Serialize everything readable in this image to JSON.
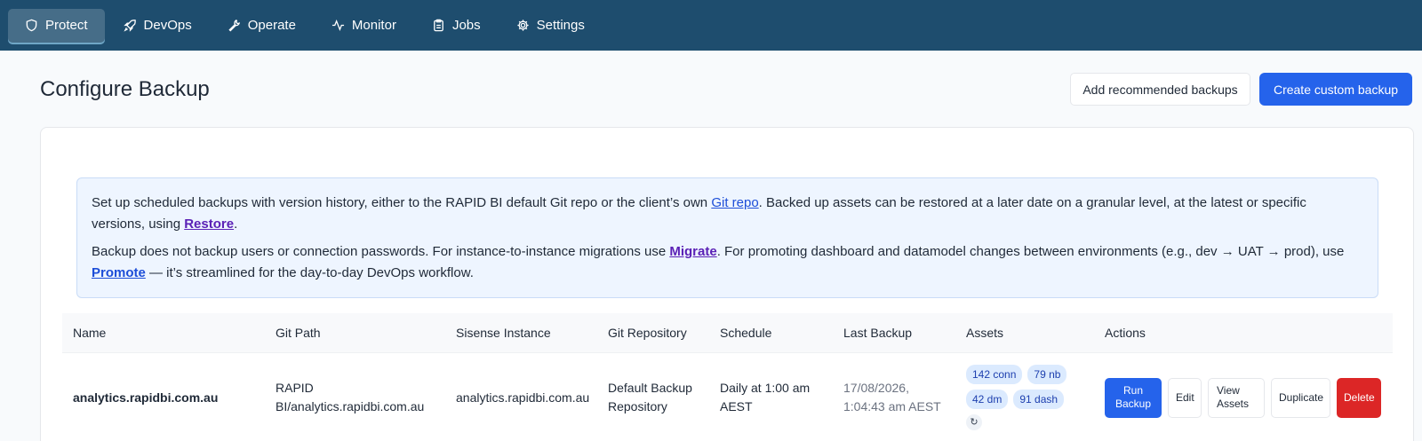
{
  "nav": {
    "items": [
      {
        "label": "Protect",
        "icon": "shield-icon",
        "active": true
      },
      {
        "label": "DevOps",
        "icon": "rocket-icon",
        "active": false
      },
      {
        "label": "Operate",
        "icon": "wrench-icon",
        "active": false
      },
      {
        "label": "Monitor",
        "icon": "activity-icon",
        "active": false
      },
      {
        "label": "Jobs",
        "icon": "clipboard-icon",
        "active": false
      },
      {
        "label": "Settings",
        "icon": "gear-icon",
        "active": false
      }
    ]
  },
  "header": {
    "title": "Configure Backup",
    "add_recommended_label": "Add recommended backups",
    "create_custom_label": "Create custom backup"
  },
  "info": {
    "p1_text1": "Set up scheduled backups with version history, either to the RAPID BI default Git repo or the client’s own ",
    "p1_link1": "Git repo",
    "p1_text2": ". Backed up assets can be restored at a later date on a granular level, at the latest or specific versions, using ",
    "p1_link2": "Restore",
    "p1_text3": ".",
    "p2_text1": "Backup does not backup users or connection passwords. For instance-to-instance migrations use ",
    "p2_link1": "Migrate",
    "p2_text2": ". For promoting dashboard and datamodel changes between environments (e.g., dev → UAT → prod), use ",
    "p2_link2": "Promote",
    "p2_text3": " — it’s streamlined for the day-to-day DevOps workflow."
  },
  "table": {
    "columns": [
      "Name",
      "Git Path",
      "Sisense Instance",
      "Git Repository",
      "Schedule",
      "Last Backup",
      "Assets",
      "Actions"
    ],
    "rows": [
      {
        "name": "analytics.rapidbi.com.au",
        "git_path_1": "RAPID",
        "git_path_2": "BI/analytics.rapidbi.com.au",
        "instance": "analytics.rapidbi.com.au",
        "repo_1": "Default Backup",
        "repo_2": "Repository",
        "schedule_1": "Daily at 1:00 am",
        "schedule_2": "AEST",
        "last_backup_1": "17/08/2026,",
        "last_backup_2": "1:04:43 am AEST",
        "assets": [
          "142 conn",
          "79 nb",
          "42 dm",
          "91 dash"
        ],
        "refresh_icon": "↻",
        "actions": {
          "run_1": "Run",
          "run_2": "Backup",
          "edit": "Edit",
          "view_1": "View",
          "view_2": "Assets",
          "duplicate": "Duplicate",
          "delete": "Delete"
        }
      }
    ]
  },
  "colors": {
    "nav_bg": "#1e4d6e",
    "primary": "#2563eb",
    "danger": "#dc2626",
    "info_bg": "#eef5ff",
    "chip_bg": "#dbeafe"
  }
}
